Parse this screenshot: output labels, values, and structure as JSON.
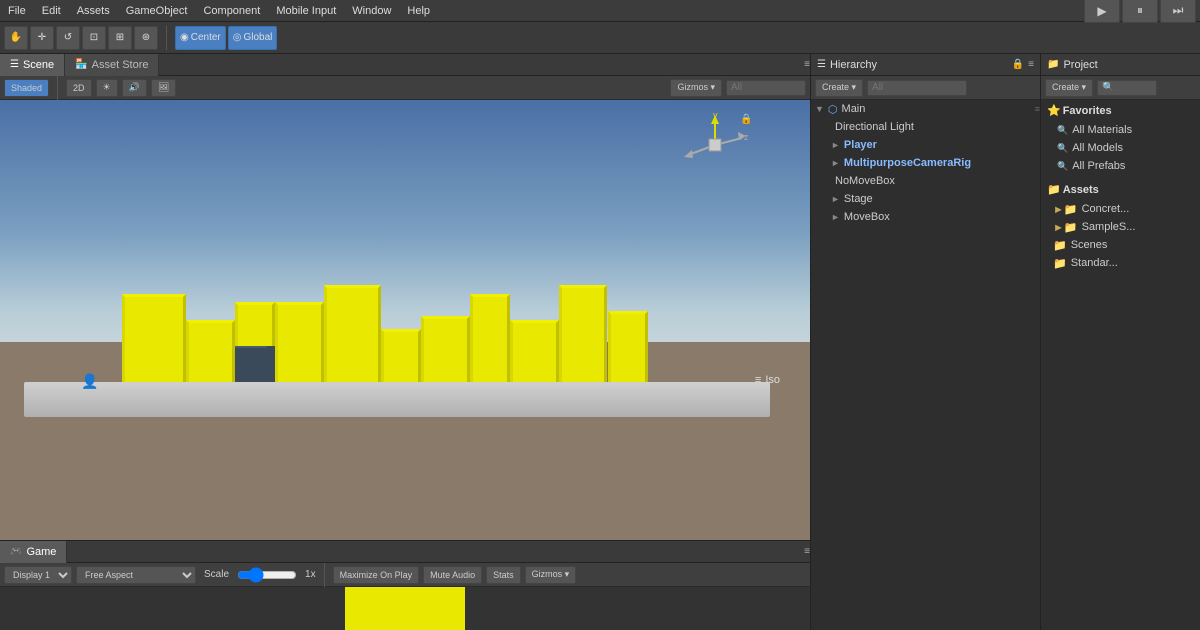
{
  "menubar": {
    "items": [
      "File",
      "Edit",
      "Assets",
      "GameObject",
      "Component",
      "Mobile Input",
      "Window",
      "Help"
    ]
  },
  "toolbar": {
    "hand_tool": "✋",
    "move_tool": "✛",
    "rotate_tool": "↺",
    "scale_tool": "⊞",
    "rect_tool": "⊡",
    "transform_tool": "⊞",
    "center_label": "Center",
    "center_icon": "◉",
    "global_label": "Global",
    "global_icon": "◎"
  },
  "play_controls": {
    "play": "▶",
    "pause": "⏸",
    "step": "⏭"
  },
  "scene_panel": {
    "tab_label": "Scene",
    "tab2_label": "Asset Store",
    "shaded_label": "Shaded",
    "twod_label": "2D",
    "sun_icon": "☀",
    "audio_icon": "🔊",
    "image_icon": "🖼",
    "gizmos_label": "Gizmos ▾",
    "search_placeholder": "All",
    "lock_icon": "🔒",
    "iso_label": "Iso",
    "menu_icon": "≡"
  },
  "hierarchy_panel": {
    "title": "Hierarchy",
    "lock_icon": "🔒",
    "menu_icon": "≡",
    "create_label": "Create ▾",
    "search_placeholder": "All",
    "items": [
      {
        "name": "Main",
        "level": 0,
        "arrow": "▼",
        "unity_icon": true
      },
      {
        "name": "Directional Light",
        "level": 1,
        "arrow": ""
      },
      {
        "name": "Player",
        "level": 1,
        "arrow": "►",
        "highlighted": true
      },
      {
        "name": "MultipurposeCameraRig",
        "level": 1,
        "arrow": "►",
        "highlighted": true
      },
      {
        "name": "NoMoveBox",
        "level": 1,
        "arrow": ""
      },
      {
        "name": "Stage",
        "level": 1,
        "arrow": "►"
      },
      {
        "name": "MoveBox",
        "level": 1,
        "arrow": "►"
      }
    ]
  },
  "project_panel": {
    "title": "Project",
    "create_label": "Create ▾",
    "search_placeholder": "",
    "favorites": {
      "title": "Favorites",
      "items": [
        "All Materials",
        "All Models",
        "All Prefabs"
      ]
    },
    "assets": {
      "title": "Assets",
      "items": [
        "Concret...",
        "SampleS...",
        "Scenes",
        "Standar..."
      ]
    }
  },
  "game_panel": {
    "tab_label": "Game",
    "menu_icon": "≡",
    "display_label": "Display 1",
    "aspect_label": "Free Aspect",
    "scale_label": "Scale",
    "scale_value": "1x",
    "maximize_label": "Maximize On Play",
    "mute_label": "Mute Audio",
    "stats_label": "Stats",
    "gizmos_label": "Gizmos ▾"
  }
}
